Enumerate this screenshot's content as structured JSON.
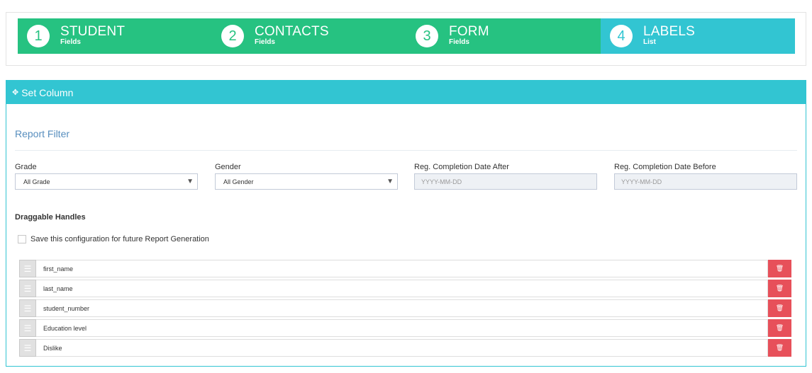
{
  "wizard": {
    "steps": [
      {
        "number": "1",
        "title": "STUDENT",
        "subtitle": "Fields"
      },
      {
        "number": "2",
        "title": "CONTACTS",
        "subtitle": "Fields"
      },
      {
        "number": "3",
        "title": "FORM",
        "subtitle": "Fields"
      },
      {
        "number": "4",
        "title": "LABELS",
        "subtitle": "List"
      }
    ],
    "active_step": 4,
    "colors": {
      "done": "#26c281",
      "active": "#32c5d2"
    }
  },
  "portlet": {
    "title": "Set Column",
    "icon": "move-icon"
  },
  "filter": {
    "section_title": "Report Filter",
    "grade": {
      "label": "Grade",
      "value": "All Grade"
    },
    "gender": {
      "label": "Gender",
      "value": "All Gender"
    },
    "date_after": {
      "label": "Reg. Completion Date After",
      "placeholder": "YYYY-MM-DD"
    },
    "date_before": {
      "label": "Reg. Completion Date Before",
      "placeholder": "YYYY-MM-DD"
    }
  },
  "handles": {
    "title": "Draggable Handles",
    "save_config_label": "Save this configuration for future Report Generation",
    "save_config_checked": false,
    "items": [
      {
        "label": "first_name"
      },
      {
        "label": "last_name"
      },
      {
        "label": "student_number"
      },
      {
        "label": "Education level"
      },
      {
        "label": "Dislike"
      }
    ]
  },
  "icons": {
    "handle": "drag-handle-icon",
    "delete": "trash-icon",
    "caret": "caret-down-icon"
  },
  "colors": {
    "delete": "#e7505a",
    "section_title": "#578ebe"
  }
}
